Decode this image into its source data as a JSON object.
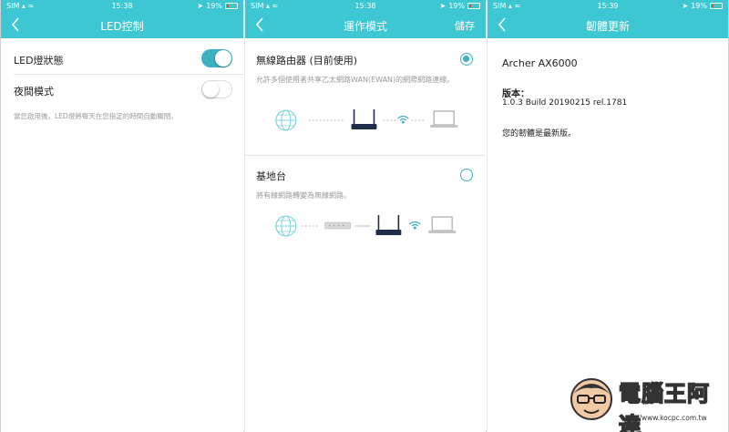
{
  "status": {
    "carrier": "SIM",
    "battery": "19%",
    "battery_level": 0.19
  },
  "panel_led": {
    "time": "15:38",
    "title": "LED控制",
    "led_status_label": "LED燈狀態",
    "led_status_on": true,
    "night_mode_label": "夜間模式",
    "night_mode_on": false,
    "note": "當您啟用後，LED燈將每天在您指定的時間自動關閉。"
  },
  "panel_mode": {
    "time": "15:38",
    "title": "運作模式",
    "save_label": "儲存",
    "router_mode": {
      "title": "無線路由器 (目前使用)",
      "desc": "允許多個使用者共享乙太網路WAN(EWAN)的網際網路連線。",
      "selected": true
    },
    "ap_mode": {
      "title": "基地台",
      "desc": "將有線網路轉變為無線網路。",
      "selected": false
    },
    "icons": [
      "globe-icon",
      "router-icon",
      "wifi-icon",
      "laptop-icon",
      "switch-icon"
    ]
  },
  "panel_firmware": {
    "time": "15:39",
    "title": "韌體更新",
    "model": "Archer AX6000",
    "version_label": "版本：",
    "version": "1.0.3 Build 20190215 rel.1781",
    "status": "您的韌體是最新版。"
  },
  "watermark": {
    "brand": "電腦王阿達",
    "url": "http://www.kocpc.com.tw"
  },
  "colors": {
    "header": "#3cc7d3",
    "accent": "#3cb1bf",
    "battery_low": "#ff3b30"
  }
}
